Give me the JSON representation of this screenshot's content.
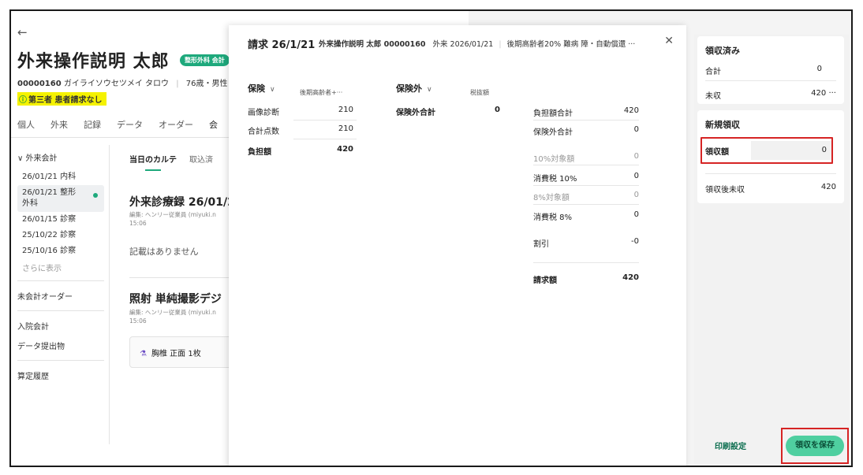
{
  "patient": {
    "name": "外来操作説明 太郎",
    "dept_badge": "整形外科 会計",
    "id": "00000160",
    "kana": "ガイライソウセツメイ タロウ",
    "age_sex": "76歳・男性",
    "third_party_note": "第三者 患者請求なし"
  },
  "nav_tabs": [
    "個人",
    "外来",
    "記録",
    "データ",
    "オーダー",
    "会"
  ],
  "sidebar": {
    "header": "外来会計",
    "items": [
      "26/01/21 内科",
      "26/01/21 整形外科",
      "26/01/15 診察",
      "25/10/22 診察",
      "25/10/16 診察"
    ],
    "more": "さらに表示",
    "unbilled_orders": "未会計オーダー",
    "inpatient": "入院会計",
    "data_submit": "データ提出物",
    "calc_history": "算定履歴"
  },
  "chart_tabs": [
    "当日のカルテ",
    "取込済"
  ],
  "records": {
    "title1": "外来診療録 26/01/2",
    "edit1": "編集: ヘンリー従業員 (miyuki.n",
    "time1": "15:06",
    "empty": "記載はありません",
    "title2": "照射 単純撮影デジ",
    "edit2": "編集: ヘンリー従業員 (miyuki.n",
    "time2": "15:06",
    "order_item": "胸椎 正面 1枚"
  },
  "bill": {
    "title": "請求 26/1/21",
    "patient": "外来操作説明 太郎 00000160",
    "visit": "外来 2026/01/21",
    "insurance_info": "後期高齢者20% 難病 障・自動償還 ···",
    "insured_head": "保険",
    "insured_sub": "後期高齢者+···",
    "insured_rows": [
      {
        "label": "画像診断",
        "value": "210"
      },
      {
        "label": "合計点数",
        "value": "210"
      },
      {
        "label": "負担額",
        "value": "420"
      }
    ],
    "uninsured_head": "保険外",
    "tax_excluded": "税抜額",
    "uninsured_rows": [
      {
        "label": "保険外合計",
        "value": "0"
      }
    ],
    "summary_rows": [
      {
        "label": "負担額合計",
        "value": "420"
      },
      {
        "label": "保険外合計",
        "value": "0"
      },
      {
        "label": "10%対象額",
        "value": "0"
      },
      {
        "label": "消費税 10%",
        "value": "0"
      },
      {
        "label": "8%対象額",
        "value": "0"
      },
      {
        "label": "消費税 8%",
        "value": "0"
      },
      {
        "label": "割引",
        "value": "-0"
      },
      {
        "label": "請求額",
        "value": "420"
      }
    ]
  },
  "receipt": {
    "received_title": "領収済み",
    "total_label": "合計",
    "total_value": "0",
    "unpaid_label": "未収",
    "unpaid_value": "420",
    "more": "···",
    "new_title": "新規領収",
    "amount_label": "領収額",
    "amount_value": "0",
    "after_label": "領収後未収",
    "after_value": "420",
    "print_settings": "印刷設定",
    "save_button": "領収を保存"
  }
}
